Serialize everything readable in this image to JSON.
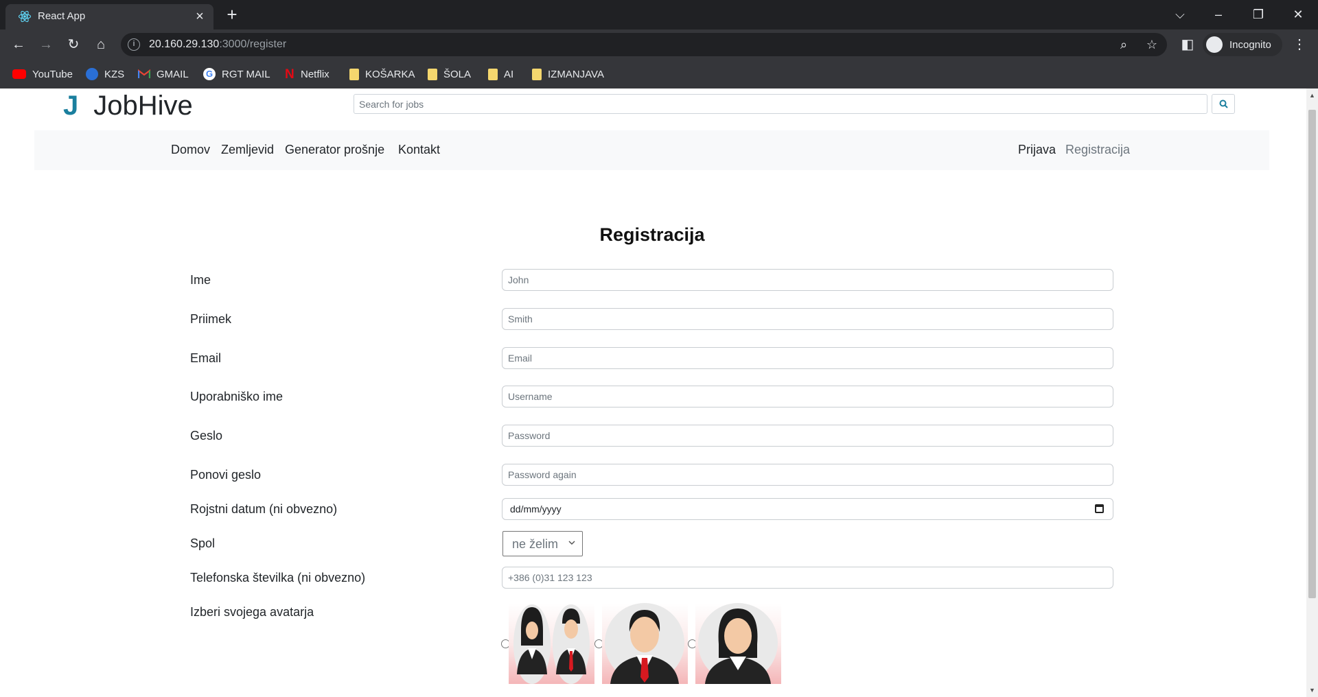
{
  "browser": {
    "tab_title": "React App",
    "url_host": "20.160.29.130",
    "url_path": ":3000/register",
    "profile_label": "Incognito",
    "bookmarks": [
      {
        "label": "YouTube",
        "icon": "youtube-icon"
      },
      {
        "label": "KZS",
        "icon": "kzs-icon"
      },
      {
        "label": "GMAIL",
        "icon": "gmail-icon"
      },
      {
        "label": "RGT MAIL",
        "icon": "google-icon"
      },
      {
        "label": "Netflix",
        "icon": "netflix-icon"
      },
      {
        "label": "KOŠARKA",
        "icon": "folder-icon"
      },
      {
        "label": "ŠOLA",
        "icon": "folder-icon"
      },
      {
        "label": "AI",
        "icon": "folder-icon"
      },
      {
        "label": "IZMANJAVA",
        "icon": "folder-icon"
      }
    ]
  },
  "header": {
    "logo_mark": "J",
    "brand_name": "JobHive",
    "search_placeholder": "Search for jobs"
  },
  "nav": {
    "left": [
      "Domov",
      "Zemljevid",
      "Generator prošnje",
      "Kontakt"
    ],
    "right": [
      "Prijava",
      "Registracija"
    ]
  },
  "form": {
    "title": "Registracija",
    "fields": [
      {
        "label": "Ime",
        "placeholder": "John"
      },
      {
        "label": "Priimek",
        "placeholder": "Smith"
      },
      {
        "label": "Email",
        "placeholder": "Email"
      },
      {
        "label": "Uporabniško ime",
        "placeholder": "Username"
      },
      {
        "label": "Geslo",
        "placeholder": "Password"
      },
      {
        "label": "Ponovi geslo",
        "placeholder": "Password again"
      }
    ],
    "birthdate": {
      "label": "Rojstni datum (ni obvezno)",
      "value": "dd/mm/yyyy"
    },
    "gender": {
      "label": "Spol",
      "selected": "ne želim"
    },
    "phone": {
      "label": "Telefonska številka (ni obvezno)",
      "placeholder": "+386 (0)31 123 123"
    },
    "avatar": {
      "label": "Izberi svojega avatarja",
      "options": [
        "couple-avatar",
        "male-avatar",
        "female-avatar"
      ]
    }
  },
  "colors": {
    "brand_accent": "#1b7f9e",
    "navbar_bg": "#f8f9fa",
    "avatar_gradient_bottom": "#f4b6b8"
  }
}
